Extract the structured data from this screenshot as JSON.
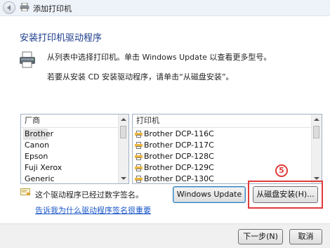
{
  "window": {
    "title": "添加打印机"
  },
  "heading": "安装打印机驱动程序",
  "description": {
    "line1": "从列表中选择打印机。单击 Windows Update 以查看更多型号。",
    "line2": "若要从安装 CD 安装驱动程序，请单击“从磁盘安装”。"
  },
  "manufacturers": {
    "header": "厂商",
    "items": [
      "Brother",
      "Canon",
      "Epson",
      "Fuji Xerox",
      "Generic"
    ],
    "selected": "Brother"
  },
  "printers": {
    "header": "打印机",
    "items": [
      "Brother DCP-116C",
      "Brother DCP-117C",
      "Brother DCP-128C",
      "Brother DCP-129C",
      "Brother DCP-130C"
    ]
  },
  "signature": {
    "text": "这个驱动程序已经过数字签名。",
    "link": "告诉我为什么驱动程序签名很重要"
  },
  "buttons": {
    "windows_update": "Windows Update",
    "have_disk": "从磁盘安装(H)...",
    "next": "下一步(N)",
    "cancel": "取消"
  },
  "annotation": {
    "step": "5"
  },
  "colors": {
    "accent": "#e03b3b",
    "heading": "#1a3a8a",
    "link": "#1a56c7"
  },
  "icons": [
    "back-arrow-icon",
    "printer-icon",
    "certificate-icon"
  ]
}
